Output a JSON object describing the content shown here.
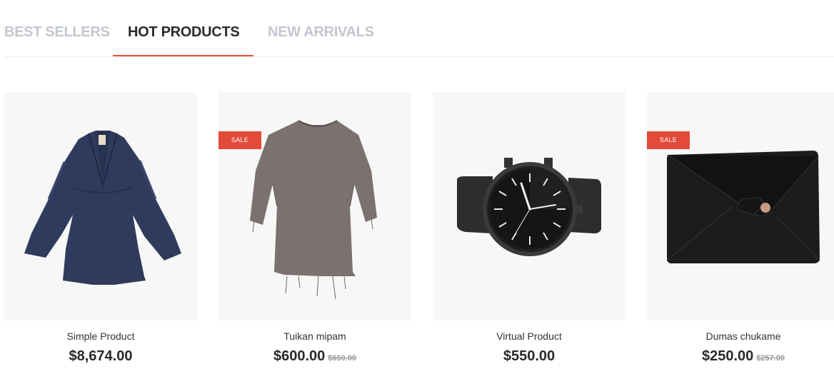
{
  "tabs": [
    {
      "label": "BEST SELLERS"
    },
    {
      "label": "HOT PRODUCTS"
    },
    {
      "label": "NEW ARRIVALS"
    }
  ],
  "active_tab": "HOT PRODUCTS",
  "accent_color": "#e45340",
  "products": [
    {
      "name": "Simple Product",
      "price": "$8,674.00",
      "old_price": "",
      "badge": "",
      "image": "dress-icon"
    },
    {
      "name": "Tuikan mipam",
      "price": "$600.00",
      "old_price": "$650.00",
      "badge": "SALE",
      "image": "tunic-dress-icon"
    },
    {
      "name": "Virtual Product",
      "price": "$550.00",
      "old_price": "",
      "badge": "",
      "image": "watch-icon"
    },
    {
      "name": "Dumas chukame",
      "price": "$250.00",
      "old_price": "$257.00",
      "badge": "SALE",
      "image": "clutch-bag-icon"
    }
  ]
}
